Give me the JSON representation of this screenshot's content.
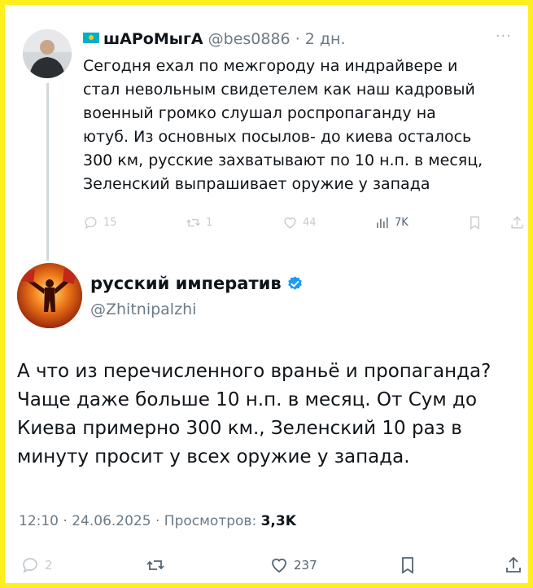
{
  "original_tweet": {
    "display_name": "шАРоМыгА",
    "handle": "@bes0886",
    "separator": "·",
    "time_ago": "2 дн.",
    "more_label": "···",
    "text_lines": [
      "Сегодня ехал по межгороду на индрайвере и",
      "стал невольным свидетелем как наш кадровый",
      "военный громко слушал роспропаганду на",
      "ютуб. Из основных посылов- до киева осталось",
      "300 км, русские захватывают по 10 н.п. в месяц,",
      "Зеленский выпрашивает оружие у запада"
    ],
    "actions": {
      "replies": "15",
      "reposts": "1",
      "likes": "44",
      "views": "7K"
    }
  },
  "quote_tweet": {
    "display_name": "русский императив",
    "handle": "@Zhitnipalzhi",
    "text_lines": [
      "А что из перечисленного враньё и пропаганда?",
      "Чаще даже больше 10 н.п. в месяц. От Сум до",
      "Киева примерно 300 км., Зеленский 10 раз в",
      "минуту просит у всех оружие у запада."
    ],
    "meta": {
      "time": "12:10",
      "separator": "·",
      "date": "24.06.2025",
      "views_label": "Просмотров:",
      "views": "3,3K"
    },
    "actions": {
      "replies": "2",
      "likes": "237"
    }
  },
  "icons": [
    "kazakhstan-flag-icon",
    "more-icon",
    "reply-icon",
    "repost-icon",
    "like-icon",
    "views-icon",
    "bookmark-icon",
    "share-icon",
    "verified-badge-icon"
  ],
  "colors": {
    "frame": "#ffef1e",
    "verified": "#1d9bf0",
    "muted_text": "#6b7a85",
    "faint_icons": "#c5ccd2"
  }
}
